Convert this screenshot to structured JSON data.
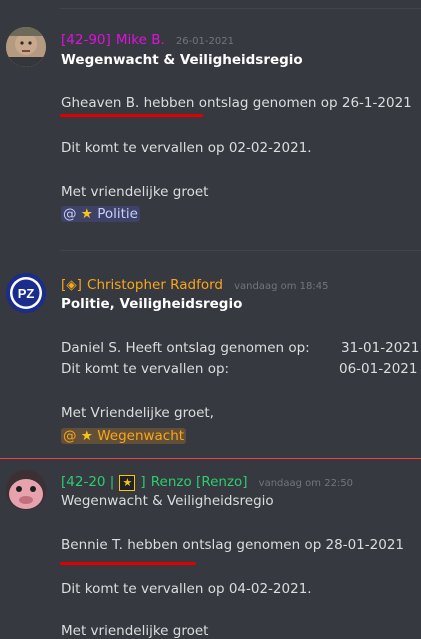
{
  "messages": [
    {
      "author_tag": "[42-90]",
      "author_name": "Mike B.",
      "author_color": "#e010e0",
      "timestamp": "26-01-2021",
      "subject": "Wegenwacht & Veiligheidsregio",
      "line1": "Gheaven B.  hebben ontslag genomen op 26-1-2021",
      "line2": "Dit komt te vervallen op 02-02-2021.",
      "line3": "Met vriendelijke groet",
      "mention": "@",
      "mention_role": "Politie",
      "avatar_icon": "face-photo"
    },
    {
      "author_tag": "[◈]",
      "author_name": "Christopher Radford",
      "author_color": "#faa61a",
      "timestamp": "vandaag om 18:45",
      "subject": "Politie, Veiligheidsregio",
      "row1_label": "Daniel S. Heeft ontslag genomen op:",
      "row1_value": "31-01-2021",
      "row2_label": "Dit komt te vervallen op:",
      "row2_value": "06-01-2021",
      "line3": "Met Vriendelijke groet,",
      "mention": "@",
      "mention_role": "Wegenwacht",
      "avatar_text": "PZ"
    },
    {
      "author_tag": "[42-20 |",
      "author_tag_end": "]",
      "author_name": "Renzo [Renzo]",
      "author_color": "#2ecc71",
      "timestamp": "vandaag om 22:50",
      "subject": "Wegenwacht & Veiligheidsregio",
      "line1": "Bennie T.  hebben ontslag genomen op 28-01-2021",
      "line2": "Dit komt te vervallen op 04-02-2021.",
      "line3": "Met vriendelijke groet",
      "avatar_icon": "pink-creature"
    }
  ],
  "colors": {
    "background": "#36393f",
    "text": "#dcddde",
    "muted": "#72767d",
    "new_divider": "#ed4245",
    "highlight": "#e00000"
  }
}
